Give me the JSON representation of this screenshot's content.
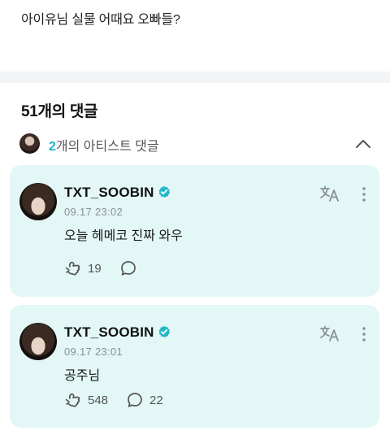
{
  "post": {
    "text": "아이유님 실물 어때요 오빠들?"
  },
  "comments_section": {
    "count_label": "51개의 댓글",
    "artist_count": "2",
    "artist_label_suffix": "개의 아티스트 댓글"
  },
  "comments": [
    {
      "author": "TXT_SOOBIN",
      "timestamp": "09.17 23:02",
      "text": "오늘 헤메코 진짜 와우",
      "likes": "19",
      "replies": ""
    },
    {
      "author": "TXT_SOOBIN",
      "timestamp": "09.17 23:01",
      "text": "공주님",
      "likes": "548",
      "replies": "22"
    }
  ],
  "colors": {
    "accent": "#1fb6c6",
    "card_bg": "#e3f7f7",
    "muted": "#8a8f94"
  },
  "icons": [
    "chevron-up-icon",
    "verified-badge-icon",
    "translate-icon",
    "more-vertical-icon",
    "like-icon",
    "comment-icon"
  ]
}
